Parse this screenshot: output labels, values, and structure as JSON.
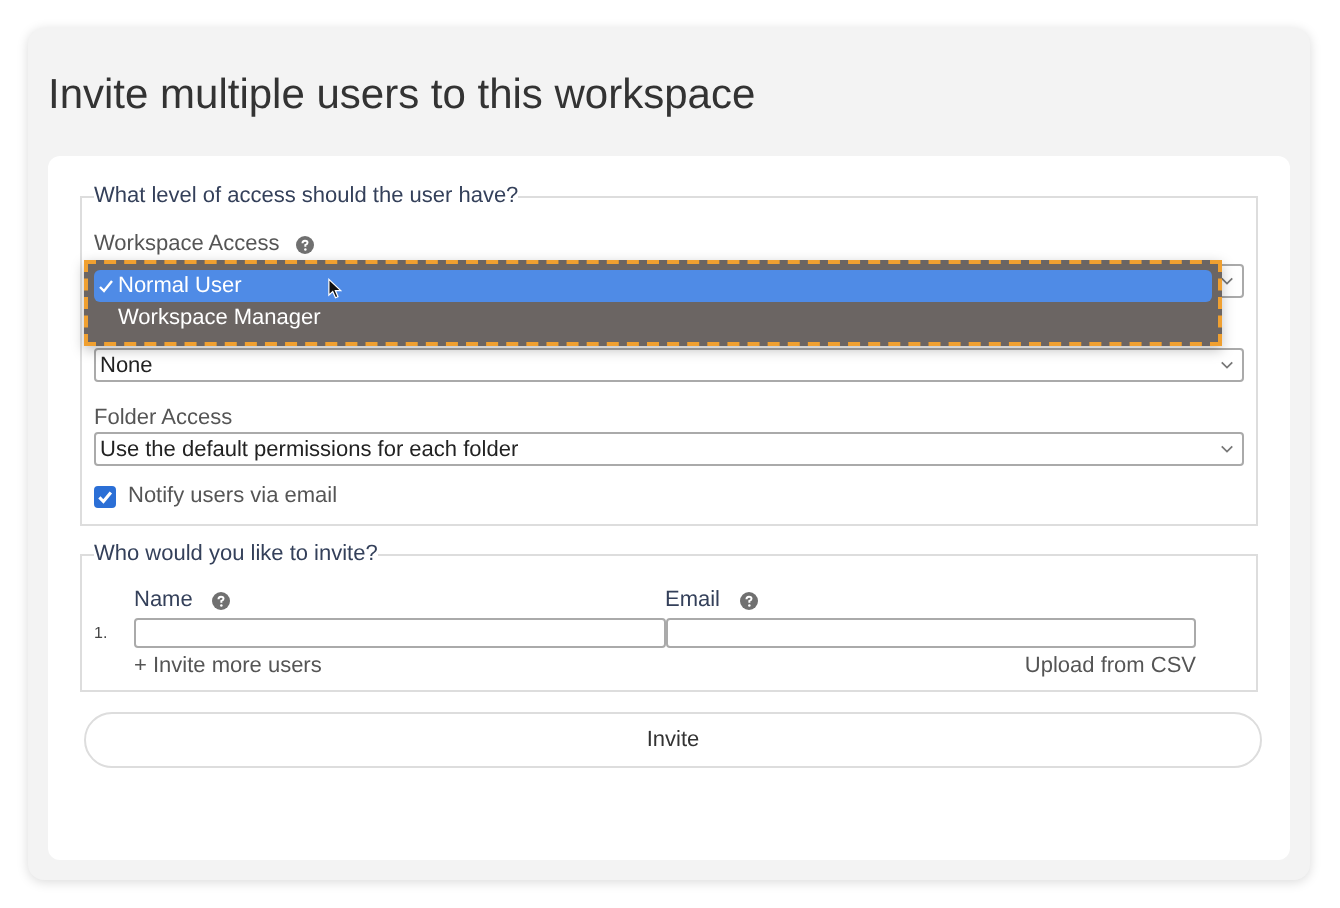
{
  "page_title": "Invite multiple users to this workspace",
  "access_section": {
    "legend": "What level of access should the user have?",
    "workspace_access": {
      "label": "Workspace Access",
      "options": [
        {
          "label": "Normal User",
          "selected": true
        },
        {
          "label": "Workspace Manager",
          "selected": false
        }
      ]
    },
    "second_select": {
      "value": "None"
    },
    "folder_access": {
      "label": "Folder Access",
      "value": "Use the default permissions for each folder"
    },
    "notify": {
      "label": "Notify users via email",
      "checked": true
    }
  },
  "invite_section": {
    "legend": "Who would you like to invite?",
    "columns": [
      {
        "label": "Name"
      },
      {
        "label": "Email"
      }
    ],
    "rows": [
      {
        "number": "1."
      }
    ],
    "add_link": "+ Invite more users",
    "upload_link": "Upload from CSV"
  },
  "invite_button": "Invite"
}
